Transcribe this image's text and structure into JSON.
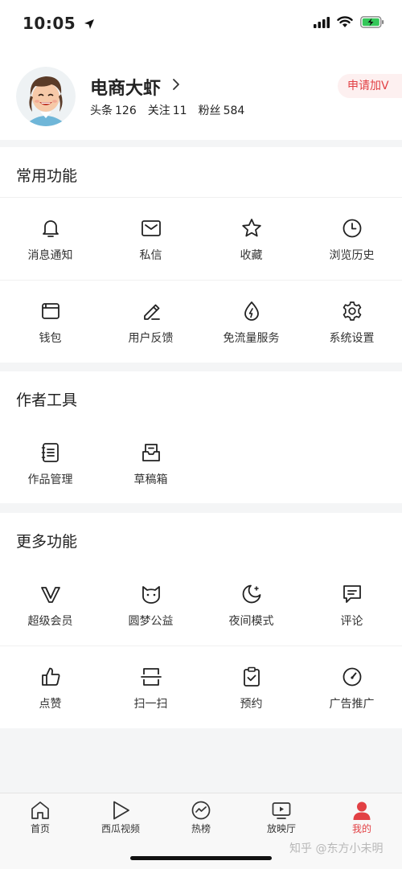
{
  "status_bar": {
    "time": "10:05"
  },
  "profile": {
    "username": "电商大虾",
    "stats": [
      {
        "label": "头条",
        "value": "126"
      },
      {
        "label": "关注",
        "value": "11"
      },
      {
        "label": "粉丝",
        "value": "584"
      }
    ],
    "apply_label": "申请加V"
  },
  "common": {
    "title": "常用功能",
    "items": [
      {
        "label": "消息通知",
        "icon": "bell-icon"
      },
      {
        "label": "私信",
        "icon": "envelope-icon"
      },
      {
        "label": "收藏",
        "icon": "star-icon"
      },
      {
        "label": "浏览历史",
        "icon": "clock-icon"
      },
      {
        "label": "钱包",
        "icon": "wallet-icon"
      },
      {
        "label": "用户反馈",
        "icon": "pen-icon"
      },
      {
        "label": "免流量服务",
        "icon": "droplet-icon"
      },
      {
        "label": "系统设置",
        "icon": "gear-icon"
      }
    ]
  },
  "author": {
    "title": "作者工具",
    "items": [
      {
        "label": "作品管理",
        "icon": "notebook-icon"
      },
      {
        "label": "草稿箱",
        "icon": "inbox-icon"
      }
    ]
  },
  "more": {
    "title": "更多功能",
    "items": [
      {
        "label": "超级会员",
        "icon": "vip-icon"
      },
      {
        "label": "圆梦公益",
        "icon": "cat-face-icon"
      },
      {
        "label": "夜间模式",
        "icon": "moon-icon"
      },
      {
        "label": "评论",
        "icon": "comment-icon"
      },
      {
        "label": "点赞",
        "icon": "thumbs-up-icon"
      },
      {
        "label": "扫一扫",
        "icon": "scan-icon"
      },
      {
        "label": "预约",
        "icon": "clipboard-check-icon"
      },
      {
        "label": "广告推广",
        "icon": "gauge-icon"
      }
    ]
  },
  "tabbar": {
    "items": [
      {
        "label": "首页",
        "icon": "home-icon"
      },
      {
        "label": "西瓜视频",
        "icon": "play-icon"
      },
      {
        "label": "热榜",
        "icon": "trend-icon"
      },
      {
        "label": "放映厅",
        "icon": "tv-play-icon"
      },
      {
        "label": "我的",
        "icon": "user-icon"
      }
    ],
    "active_color": "#e24044"
  },
  "watermark": "知乎 @东方小未明",
  "colors": {
    "accent": "#e24044",
    "background": "#f4f5f6",
    "badge_bg": "#fdf0f0"
  }
}
